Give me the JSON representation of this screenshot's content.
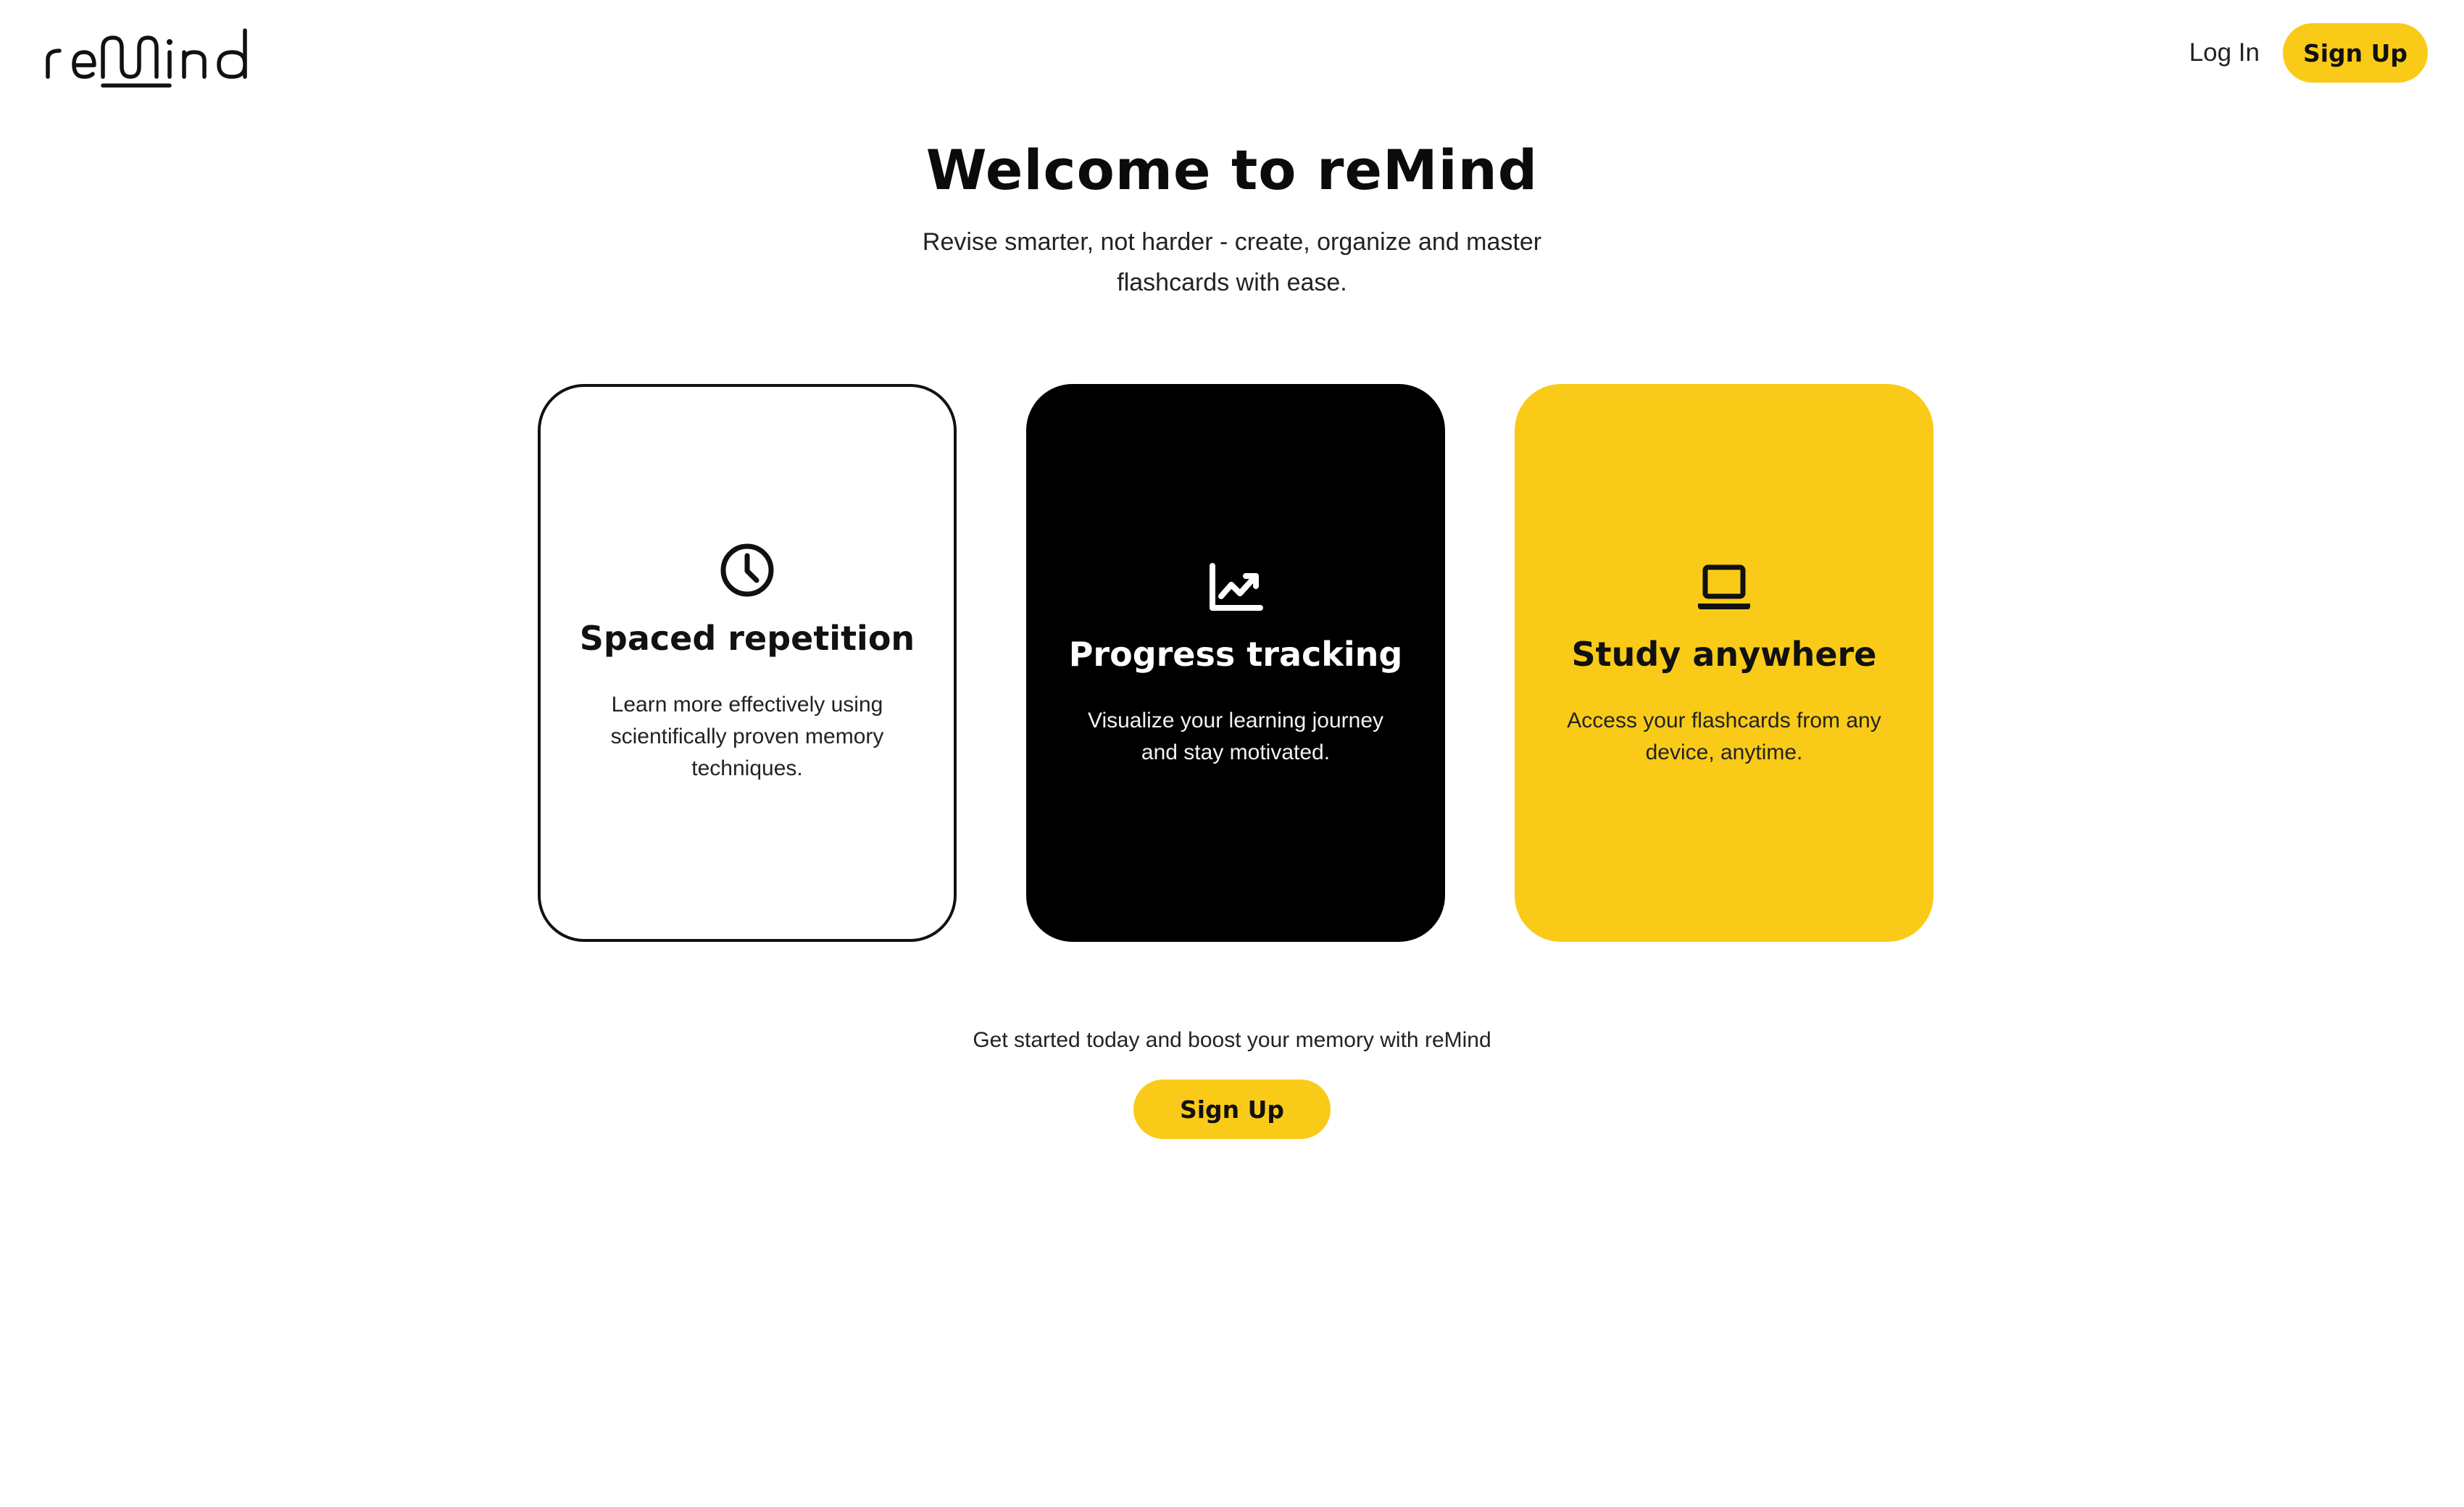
{
  "brand": {
    "logo_text": "reMind",
    "accent_color": "#f9cb18",
    "dark_color": "#000000"
  },
  "header": {
    "login_label": "Log In",
    "signup_label": "Sign Up"
  },
  "hero": {
    "title": "Welcome to reMind",
    "subtitle": "Revise smarter, not harder - create, organize and master flashcards with ease."
  },
  "features": [
    {
      "icon": "clock-icon",
      "title": "Spaced repetition",
      "description": "Learn more effectively using scientifically proven memory techniques."
    },
    {
      "icon": "chart-line-icon",
      "title": "Progress tracking",
      "description": "Visualize your learning journey and stay motivated."
    },
    {
      "icon": "laptop-icon",
      "title": "Study anywhere",
      "description": "Access your flashcards from any device, anytime."
    }
  ],
  "cta": {
    "text": "Get started today and boost your memory with reMind",
    "button_label": "Sign Up"
  }
}
